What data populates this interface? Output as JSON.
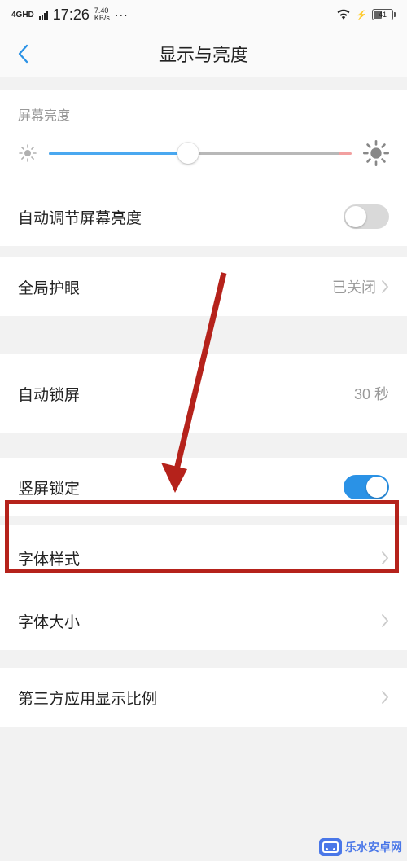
{
  "status": {
    "network_label": "4GHD",
    "time": "17:26",
    "speed_top": "7.40",
    "speed_bottom": "KB/s",
    "battery_pct": "41"
  },
  "header": {
    "title": "显示与亮度"
  },
  "brightness": {
    "label": "屏幕亮度",
    "value_pct": 46
  },
  "rows": {
    "auto_brightness": {
      "label": "自动调节屏幕亮度",
      "on": false
    },
    "eye_protect": {
      "label": "全局护眼",
      "value": "已关闭"
    },
    "auto_lock": {
      "label": "自动锁屏",
      "value": "30 秒"
    },
    "portrait_lock": {
      "label": "竖屏锁定",
      "on": true
    },
    "font_style": {
      "label": "字体样式"
    },
    "font_size": {
      "label": "字体大小"
    },
    "third_party_scale": {
      "label": "第三方应用显示比例"
    }
  },
  "watermark": {
    "text": "乐水安卓网"
  },
  "annotation": {
    "highlight_target": "font_style"
  }
}
